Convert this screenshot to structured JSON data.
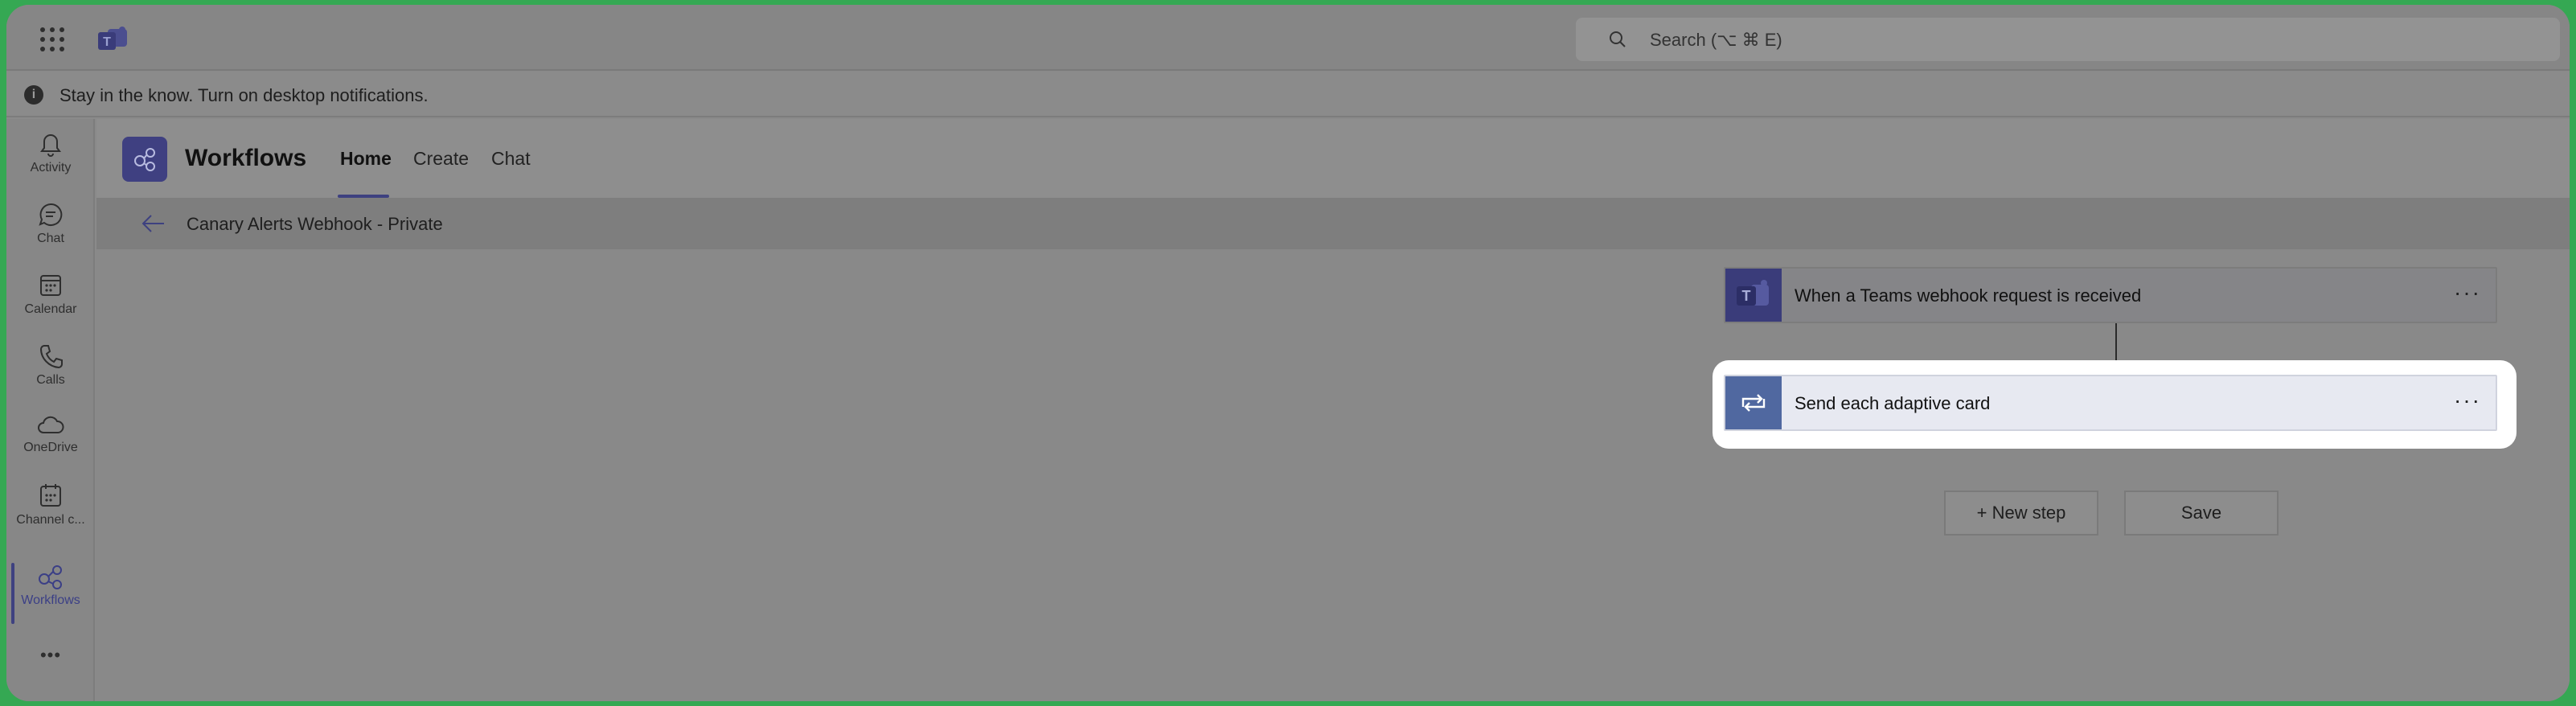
{
  "app": {
    "search_placeholder": "Search (⌥ ⌘ E)",
    "notification": "Stay in the know. Turn on desktop notifications."
  },
  "rail": {
    "items": [
      {
        "label": "Activity",
        "icon": "bell-icon"
      },
      {
        "label": "Chat",
        "icon": "chat-icon"
      },
      {
        "label": "Calendar",
        "icon": "calendar-icon"
      },
      {
        "label": "Calls",
        "icon": "phone-icon"
      },
      {
        "label": "OneDrive",
        "icon": "cloud-icon"
      },
      {
        "label": "Channel c...",
        "icon": "channel-calendar-icon"
      },
      {
        "label": "Workflows",
        "icon": "workflows-icon",
        "active": true
      }
    ],
    "more": "•••"
  },
  "header": {
    "title": "Workflows",
    "tabs": [
      {
        "label": "Home",
        "active": true
      },
      {
        "label": "Create"
      },
      {
        "label": "Chat"
      }
    ]
  },
  "breadcrumb": {
    "title": "Canary Alerts Webhook - Private"
  },
  "flow": {
    "steps": [
      {
        "title": "When a Teams webhook request is received",
        "menu": "···",
        "icon": "teams-icon"
      },
      {
        "title": "Send each adaptive card",
        "menu": "···",
        "icon": "loop-icon"
      }
    ],
    "new_step_label": "+ New step",
    "save_label": "Save"
  },
  "colors": {
    "accent": "#3e4180",
    "loop_icon_bg": "#5068a0",
    "frame_border": "#35a853"
  }
}
